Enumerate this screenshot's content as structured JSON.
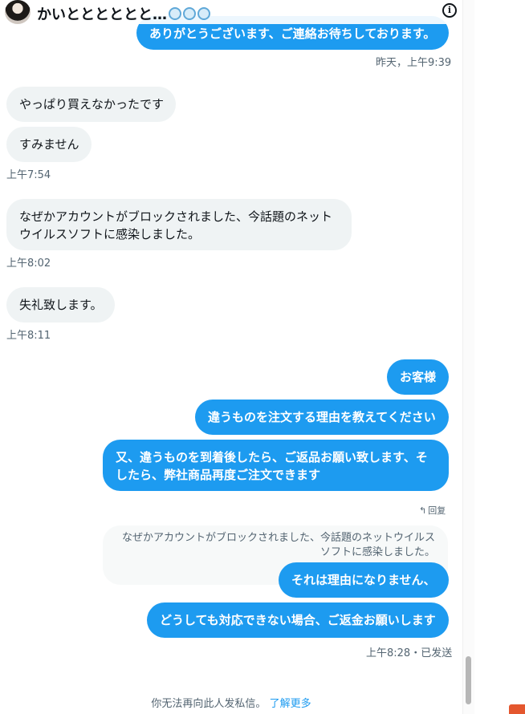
{
  "header": {
    "title": "かいとととととと…",
    "info_icon": "info-icon"
  },
  "messages": {
    "m0": "ありがとうございます、ご連絡お待ちしております。",
    "t0": "昨天，上午9:39",
    "m1": "やっぱり買えなかったです",
    "m2": "すみません",
    "t2": "上午7:54",
    "m3_line1": "なぜかアカウントがブロックされました、今話題のネット",
    "m3_line2": "ウイルスソフトに感染しました。",
    "t3": "上午8:02",
    "m4": "失礼致します。",
    "t4": "上午8:11",
    "m5": "お客様",
    "m6": "違うものを注文する理由を教えてください",
    "m7_line1": "又、違うものを到着後したら、ご返品お願い致します、そ",
    "m7_line2": "したら、弊社商品再度ご注文できます",
    "reply_label": "回复",
    "quote_line1": "なぜかアカウントがブロックされました、今話題のネットウイルス",
    "quote_line2": "ソフトに感染しました。",
    "m8": "それは理由になりません、",
    "m9": "どうしても対応できない場合、ご返金お願いします",
    "t9": "上午8:28・已发送"
  },
  "footer": {
    "notice": "你无法再向此人发私信。",
    "learn_more": "了解更多"
  },
  "colors": {
    "outgoing_bubble": "#1d9bf0",
    "incoming_bubble": "#eff3f4",
    "link": "#1d9bf0",
    "muted_text": "#536471"
  }
}
